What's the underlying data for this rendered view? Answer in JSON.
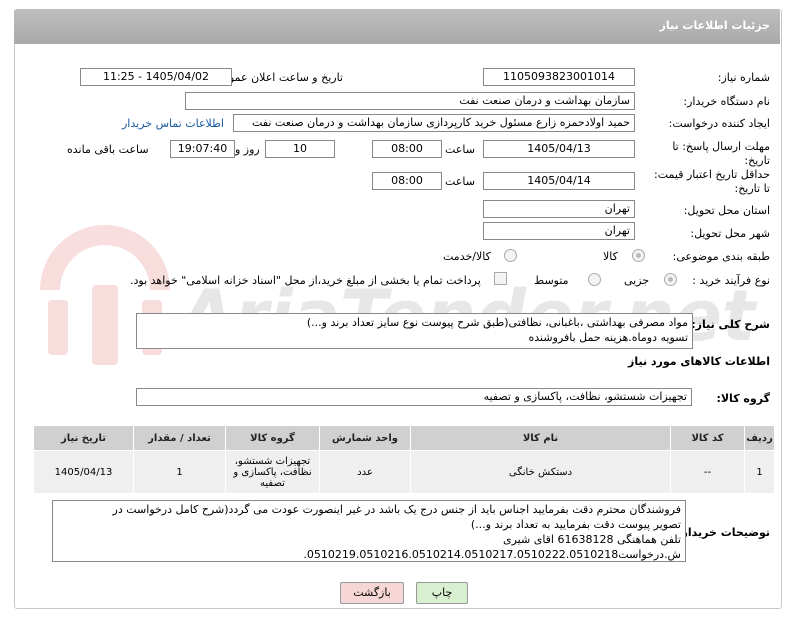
{
  "header": {
    "title": "جزئیات اطلاعات نیاز"
  },
  "fields": {
    "need_number_label": "شماره نیاز:",
    "need_number": "1105093823001014",
    "announce_label": "تاریخ و ساعت اعلان عمومی:",
    "announce_value": "1405/04/02 - 11:25",
    "buyer_org_label": "نام دستگاه خریدار:",
    "buyer_org": "سازمان بهداشت و درمان صنعت نفت",
    "creator_label": "ایجاد کننده درخواست:",
    "creator": "حمید اولادحمزه زارع مسئول خرید کارپردازی سازمان بهداشت و درمان صنعت نفت",
    "contact_link": "اطلاعات تماس خریدار",
    "deadline_label": "مهلت ارسال پاسخ: تا تاریخ:",
    "deadline_date": "1405/04/13",
    "time_label": "ساعت",
    "deadline_time": "08:00",
    "days_value": "10",
    "days_label": "روز و",
    "remaining_time": "19:07:40",
    "remaining_label": "ساعت باقی مانده",
    "validity_label": "حداقل تاریخ اعتبار قیمت: تا تاریخ:",
    "validity_date": "1405/04/14",
    "validity_time": "08:00",
    "province_label": "استان محل تحویل:",
    "province": "تهران",
    "city_label": "شهر محل تحویل:",
    "city": "تهران",
    "category_label": "طبقه بندی موضوعی:",
    "category_goods": "کالا",
    "category_service": "کالا/خدمت",
    "process_label": "نوع فرآیند خرید :",
    "process_partial": "جزیی",
    "process_medium": "متوسط",
    "payment_note": "پرداخت تمام یا بخشی از مبلغ خرید،از محل \"اسناد خزانه اسلامی\" خواهد بود."
  },
  "description": {
    "label": "شرح کلی نیاز:",
    "line1": "مواد مصرفی بهداشتی ،باغبانی، نظافتی(طبق شرح پیوست نوع سایز تعداد برند و...)",
    "line2": "تسویه دوماه.هزینه حمل بافروشنده"
  },
  "goods_info": {
    "title": "اطلاعات کالاهای مورد نیاز",
    "group_label": "گروه کالا:",
    "group_value": "تجهیزات شستشو، نظافت، پاکسازی و تصفیه"
  },
  "table": {
    "headers": [
      "ردیف",
      "کد کالا",
      "نام کالا",
      "واحد شمارش",
      "گروه کالا",
      "تعداد / مقدار",
      "تاریخ نیاز"
    ],
    "rows": [
      {
        "row": "1",
        "code": "--",
        "name": "دستکش خانگی",
        "unit": "عدد",
        "group": "تجهیزات شستشو، نظافت، پاکسازی و تصفیه",
        "qty": "1",
        "date": "1405/04/13"
      }
    ]
  },
  "buyer_notes": {
    "label": "توضیحات خریدار:",
    "line1": "فروشندگان محترم دقت بفرمایید اجناس باید از جنس درج یک باشد در غیر اینصورت عودت می گردد(شرح کامل درخواست در",
    "line2": "تصویر پیوست دقت بفرمایید به تعداد برند و...)",
    "line3": "تلفن هماهنگی 61638128 اقای شیری",
    "line4": "ش.درخواست0510219.0510216.0510214.0510217.0510222.0510218."
  },
  "buttons": {
    "print": "چاپ",
    "back": "بازگشت"
  },
  "colors": {
    "header": "#b0b0b0",
    "link": "#1a5aa0",
    "back_bg": "#f7d6d6",
    "print_bg": "#d8f0d0"
  }
}
